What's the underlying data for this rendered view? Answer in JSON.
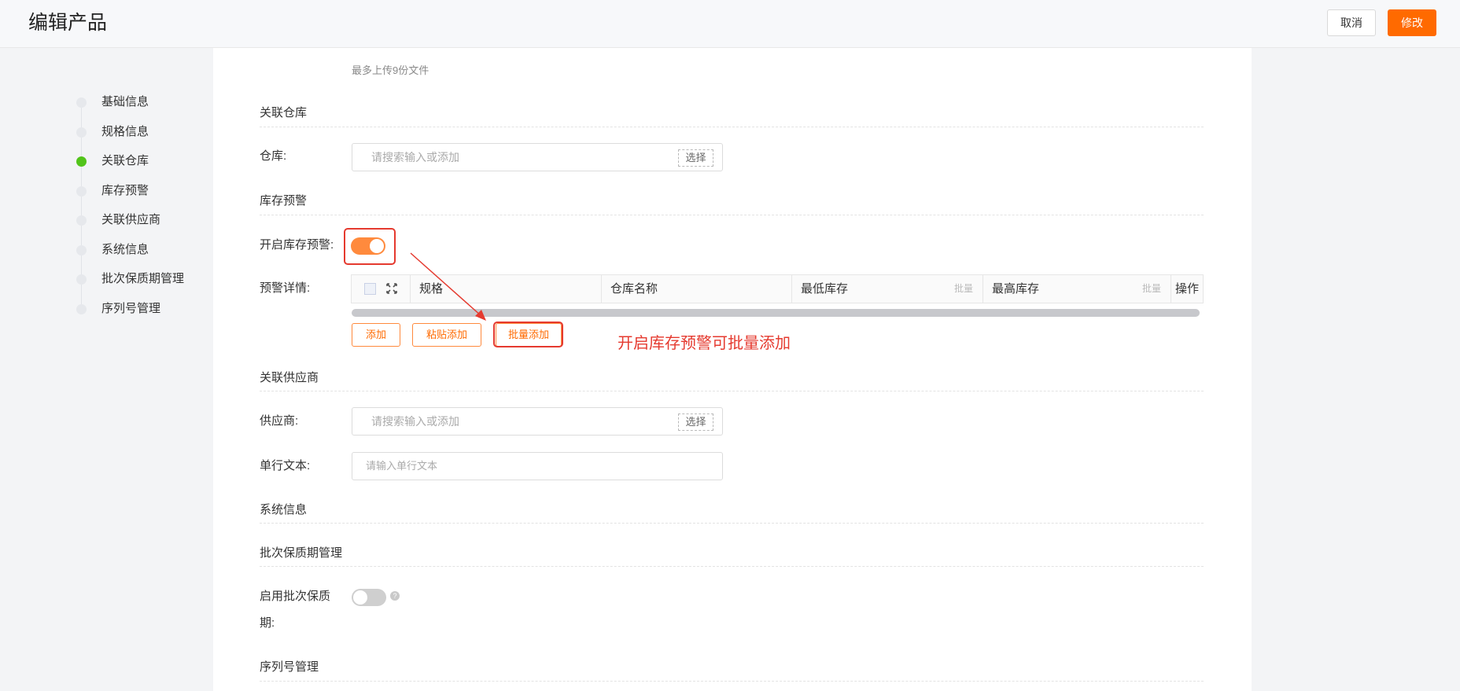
{
  "header": {
    "title": "编辑产品",
    "cancel_label": "取消",
    "save_label": "修改"
  },
  "nav": {
    "items": [
      {
        "label": "基础信息",
        "active": false
      },
      {
        "label": "规格信息",
        "active": false
      },
      {
        "label": "关联仓库",
        "active": true
      },
      {
        "label": "库存预警",
        "active": false
      },
      {
        "label": "关联供应商",
        "active": false
      },
      {
        "label": "系统信息",
        "active": false
      },
      {
        "label": "批次保质期管理",
        "active": false
      },
      {
        "label": "序列号管理",
        "active": false
      }
    ]
  },
  "form": {
    "upload_hint": "最多上传9份文件",
    "warehouse": {
      "section": "关联仓库",
      "label": "仓库:",
      "placeholder": "请搜索输入或添加",
      "choose_label": "选择"
    },
    "stock_warning": {
      "section": "库存预警",
      "toggle_label": "开启库存预警:",
      "enabled": true,
      "detail_label": "预警详情:",
      "columns": [
        "规格",
        "仓库名称",
        "最低库存",
        "最高库存",
        "操作"
      ],
      "batch_label": "批量",
      "buttons": {
        "add": "添加",
        "paste_add": "粘贴添加",
        "batch_add": "批量添加"
      },
      "annotation": "开启库存预警可批量添加"
    },
    "supplier": {
      "section": "关联供应商",
      "label": "供应商:",
      "placeholder": "请搜索输入或添加",
      "choose_label": "选择",
      "text_label": "单行文本:",
      "text_placeholder": "请输入单行文本"
    },
    "system": {
      "section": "系统信息"
    },
    "batch_expiry": {
      "section": "批次保质期管理",
      "label_line1": "启用批次保质",
      "label_line2": "期:",
      "enabled": false,
      "help": "?"
    },
    "serial": {
      "section": "序列号管理"
    }
  },
  "colors": {
    "accent": "#ff6a00",
    "toggle_on": "#ff8a3d",
    "annotation": "#e53a2f",
    "active_dot": "#52c41a"
  }
}
